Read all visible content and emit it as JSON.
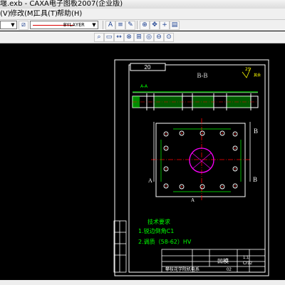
{
  "window": {
    "title": "堰.exb - CAXA电子图板2007(企业版)"
  },
  "menu": {
    "items": [
      "(V)",
      "修改(M)",
      "工具(T)",
      "帮助(H)"
    ]
  },
  "toolbar": {
    "linetype_value": "BYLAYER"
  },
  "drawing": {
    "code_box": "20",
    "section_label": "B-B",
    "section_a": "A-A",
    "roughness": "25",
    "roughness_rest": "其余",
    "label_b_top": "B",
    "label_b_bottom": "B",
    "label_a_left": "A",
    "label_a_bottom": "A",
    "tech_title": "技术要求",
    "tech_line1": "1.锐边倒角C1",
    "tech_line2": "2.调质（58-62）HV",
    "part_name": "凹模",
    "material": "Cr12",
    "scale": "1:1",
    "school": "攀枝花学院机电系",
    "sheet": "02"
  }
}
